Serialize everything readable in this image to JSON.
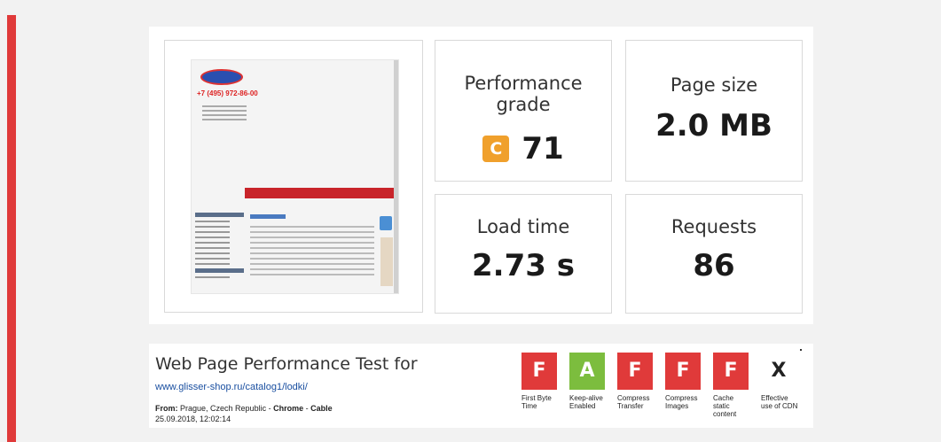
{
  "summary": {
    "performance": {
      "label": "Performance grade",
      "grade": "C",
      "score": "71",
      "grade_color": "#f0a02c"
    },
    "page_size": {
      "label": "Page size",
      "value": "2.0 MB"
    },
    "load_time": {
      "label": "Load time",
      "value": "2.73 s"
    },
    "requests": {
      "label": "Requests",
      "value": "86"
    }
  },
  "thumbnail": {
    "phone": "+7 (495) 972-86-00"
  },
  "test": {
    "title": "Web Page Performance Test for",
    "url": "www.glisser-shop.ru/catalog1/lodki/",
    "from_label": "From:",
    "location": "Prague, Czech Republic",
    "separator": "-",
    "browser": "Chrome",
    "connection": "Cable",
    "date": "25.09.2018, 12:02:14"
  },
  "grades": [
    {
      "grade": "F",
      "label_lines": [
        "First Byte",
        "Time"
      ],
      "color": "#e03a3a"
    },
    {
      "grade": "A",
      "label_lines": [
        "Keep-alive",
        "Enabled"
      ],
      "color": "#7cbd3e"
    },
    {
      "grade": "F",
      "label_lines": [
        "Compress",
        "Transfer"
      ],
      "color": "#e03a3a"
    },
    {
      "grade": "F",
      "label_lines": [
        "Compress",
        "Images"
      ],
      "color": "#e03a3a"
    },
    {
      "grade": "F",
      "label_lines": [
        "Cache",
        "static",
        "content"
      ],
      "color": "#e03a3a"
    },
    {
      "grade": "X",
      "label_lines": [
        "Effective",
        "use of CDN"
      ],
      "color": "#ffffff"
    }
  ]
}
